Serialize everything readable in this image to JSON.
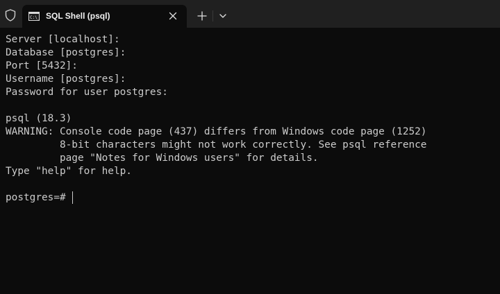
{
  "tab": {
    "title": "SQL Shell (psql)",
    "icon": "console-icon"
  },
  "titlebar": {
    "shield_icon": "shield-icon",
    "new_tab_icon": "plus-icon",
    "dropdown_icon": "chevron-down-icon",
    "close_icon": "close-icon"
  },
  "terminal": {
    "lines": [
      "Server [localhost]:",
      "Database [postgres]:",
      "Port [5432]:",
      "Username [postgres]:",
      "Password for user postgres:",
      "",
      "psql (18.3)",
      "WARNING: Console code page (437) differs from Windows code page (1252)",
      "         8-bit characters might not work correctly. See psql reference",
      "         page \"Notes for Windows users\" for details.",
      "Type \"help\" for help.",
      ""
    ],
    "prompt": "postgres=# "
  },
  "colors": {
    "background": "#0c0c0c",
    "tabbar": "#202020",
    "text": "#cccccc"
  }
}
